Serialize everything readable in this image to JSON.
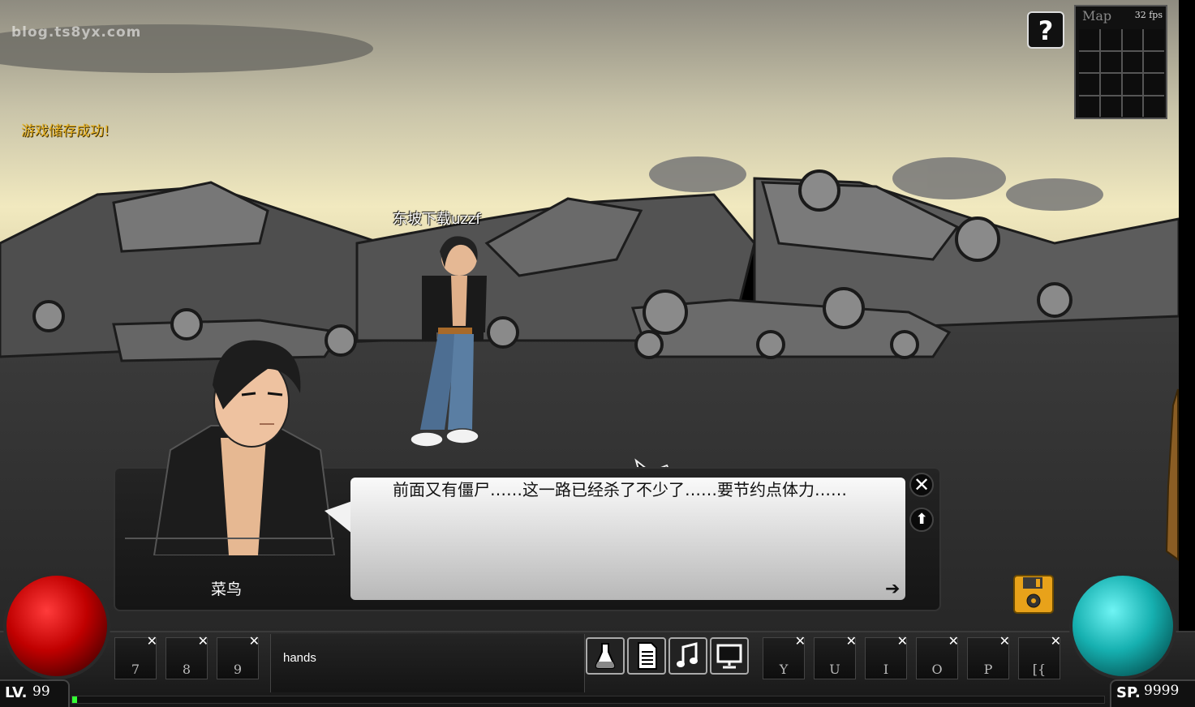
{
  "watermark": "blog.ts8yx.com",
  "save_message": "游戏储存成功!",
  "help_button": "?",
  "minimap": {
    "label": "Map",
    "fps": "32 fps"
  },
  "player_name": "东坡下载uzzf",
  "dialog": {
    "speaker": "菜鸟",
    "text": "前面又有僵尸……这一路已经杀了不少了……要节约点体力……",
    "close_icon": "✕",
    "up_icon": "⬆",
    "next_icon": "➔"
  },
  "skill_slots_left": [
    "7",
    "8",
    "9"
  ],
  "item_text": "hands",
  "menu_buttons": [
    "potion-icon",
    "document-icon",
    "music-icon",
    "monitor-icon"
  ],
  "skill_slots_right": [
    "Y",
    "U",
    "I",
    "O",
    "P",
    "[{"
  ],
  "slot_remove_icon": "✕",
  "level": {
    "label": "LV.",
    "value": "99"
  },
  "sp": {
    "label": "SP.",
    "value": "9999"
  },
  "xp_fraction": 0.005,
  "colors": {
    "hp_orb": "#c00000",
    "sp_orb": "#16b0b0",
    "save_msg": "#e8b325",
    "xp": "#33ff33"
  }
}
